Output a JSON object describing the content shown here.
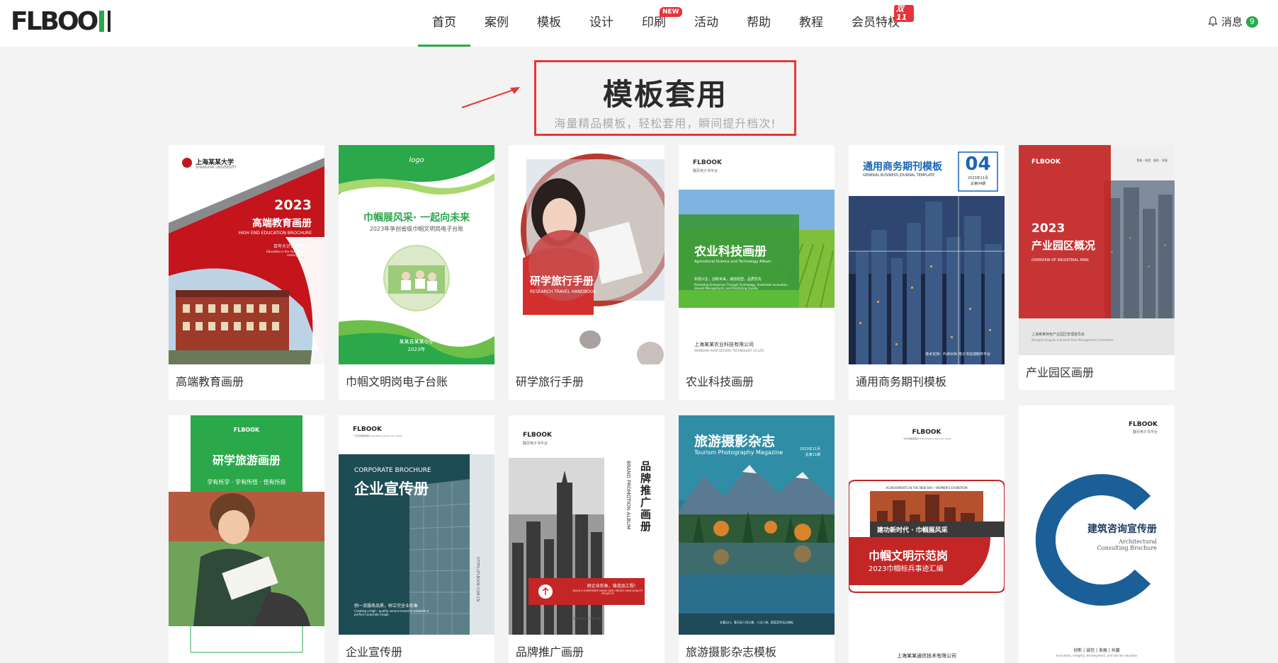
{
  "header": {
    "logo_text": "FLBOOK",
    "nav": [
      {
        "label": "首页",
        "active": true
      },
      {
        "label": "案例"
      },
      {
        "label": "模板"
      },
      {
        "label": "设计"
      },
      {
        "label": "印刷",
        "badge": "NEW"
      },
      {
        "label": "活动"
      },
      {
        "label": "帮助"
      },
      {
        "label": "教程"
      },
      {
        "label": "会员特权",
        "badge": "双11"
      }
    ],
    "messages_label": "消息",
    "messages_count": "9"
  },
  "hero": {
    "title": "模板套用",
    "subtitle": "海量精品模板，轻松套用，瞬间提升档次!"
  },
  "colors": {
    "brand_green": "#2aa84a",
    "highlight_red": "#e53935"
  },
  "templates": [
    {
      "name": "高端教育画册",
      "cover": {
        "org": "上海某某大学",
        "org_en": "SHANGHAI UNIVERSITY",
        "year": "2023",
        "title": "高端教育画册",
        "en": "HIGH END EDUCATION BROCHURE",
        "tagline": "百年大计，教育为本",
        "tagline_en": "Education is the foundation of a century long plan"
      }
    },
    {
      "name": "巾帼文明岗电子台账",
      "cover": {
        "logo": "logo",
        "title": "巾帼展风采· 一起向未来",
        "sub": "2023年争创省级巾帼文明岗电子台账",
        "school": "某某县某某小学",
        "year": "2023年"
      }
    },
    {
      "name": "研学旅行手册",
      "cover": {
        "title": "研学旅行手册",
        "en": "RESEARCH TRAVEL HANDBOOK"
      }
    },
    {
      "name": "农业科技画册",
      "cover": {
        "logo": "FLBOOK",
        "logo_sub": "翻页电子书平台",
        "title": "农业科技画册",
        "en": "Agricultural Science and Technology Album",
        "slogan": "科技兴企，创新未来，诚信经营，品质优先",
        "slogan_en": "Promoting Enterprises Through Technology, Undertake Innovation, Honest Management, and Prioritizing Quality",
        "company": "上海某某农业科技有限公司",
        "company_en": "SHANGHAI AGRICULTURAL TECHNOLOGY CO.,LTD."
      }
    },
    {
      "name": "通用商务期刊模板",
      "cover": {
        "title": "通用商务期刊模板",
        "en": "GENERAL BUSINESS JOURNAL TEMPLATE",
        "issue": "04",
        "date": "2023年11月",
        "issue_label": "总第04期",
        "footer": "技术支持：FLBOOK 电子书在线制作平台"
      }
    },
    {
      "name": "产业园区画册",
      "cover": {
        "logo": "FLBOOK",
        "top_right": "智能 · 制造 · 服务 · 发展",
        "year": "2023",
        "title": "产业园区概况",
        "en": "OVERVIEW OF INDUSTRIAL PARK",
        "committee": "上海某某特色产业园区管理委员会",
        "committee_en": "Shanghai Jiugeliu Industrial Park Management Committee"
      }
    },
    {
      "name": "研学旅游画册",
      "cover": {
        "logo": "FLBOOK",
        "title": "研学旅游画册",
        "slogan": "学有所学 · 学有所悟 · 悟有所获"
      }
    },
    {
      "name": "企业宣传册",
      "cover": {
        "logo": "FLBOOK",
        "logo_sub": "一切为你做的更好 Everything serves your needs",
        "en": "CORPORATE BROCHURE",
        "title": "企业宣传册",
        "slogan": "例一流服务品质，树立完全业形象",
        "slogan_en": "Creating a high - quality service brand to establish a perfect corporate image",
        "side": "HTTPS://FLBOOK.COM.CN"
      }
    },
    {
      "name": "品牌推广画册",
      "cover": {
        "logo": "FLBOOK",
        "logo_sub": "翻页电子书平台",
        "title_v": "品牌推广画册",
        "en_v": "BRAND PROMOTION ALBUM",
        "banner": "树企业形象，铸造品工程!",
        "banner_en": "BUILD A CORPORATE IMAGE AND CREATE HIGH-QUALITY PROJECTS",
        "url": "FLBOOK.COM.CN"
      }
    },
    {
      "name": "旅游摄影杂志模板",
      "cover": {
        "title": "旅游摄影杂志",
        "en": "Tourism Photography Magazine",
        "date": "2023年11月",
        "issue": "总第11期",
        "footer": "去看山川，看天际人间之美，人达人海，蔚蓝至色无边海际"
      }
    },
    {
      "name": "",
      "cover": {
        "logo": "FLBOOK",
        "logo_sub": "一切为你做的更好 Everything serves your needs",
        "en": "ACHIEVEMENTS IN THE NEW ERA • WOMEN'S EXHIBITION",
        "banner": "建功新时代 · 巾帼展风采",
        "title": "巾帼文明示范岗",
        "sub": "2023巾帼标兵事迹汇编",
        "company": "上海某某通信技术有限公司"
      }
    },
    {
      "name": "",
      "cover": {
        "logo": "FLBOOK",
        "logo_sub": "翻页电子书平台",
        "title": "建筑咨询宣传册",
        "en": "Architectural Consulting Brochure",
        "footer": "创新 | 诚信 | 发展 | 共赢",
        "footer_en": "Innovation, integrity, development, and win-win situation"
      }
    }
  ]
}
